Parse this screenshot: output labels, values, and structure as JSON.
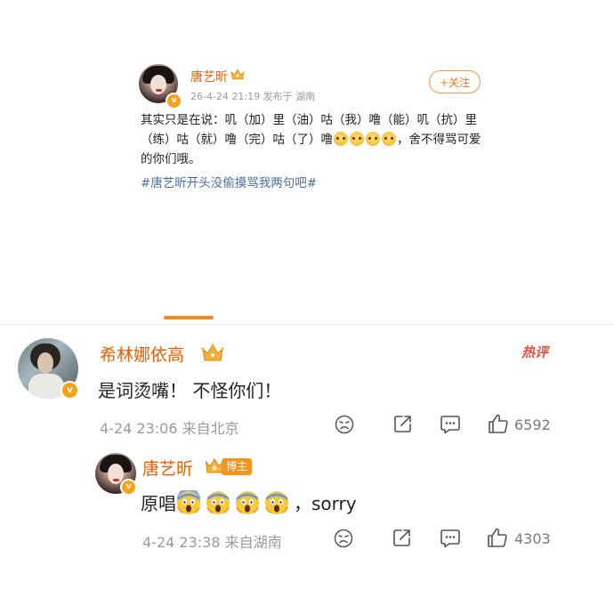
{
  "post": {
    "author": "唐艺昕",
    "verified_mark": "v",
    "meta": "26-4-24 21:19  发布于 湖南",
    "follow_label": "+关注",
    "text_part1": "其实只是在说：叽（加）里（油）咕（我）噜（能）叽（抗）里（练）咕（就）噜（完）咕（了）噜",
    "text_part2": "，舍不得骂可爱的你们哦。",
    "text_emojis": [
      "crying-face-emoji",
      "crying-face-emoji",
      "crying-face-emoji",
      "crying-face-emoji"
    ],
    "hashtag": "#唐艺昕开头没偷摸骂我两句吧#"
  },
  "comment": {
    "author": "希林娜依高",
    "hot_label": "热评",
    "text": "是词烫嘴！ 不怪你们！",
    "meta": "4-24 23:06  来自北京",
    "like_count": "6592",
    "actions": [
      "dislike-icon",
      "share-icon",
      "comment-icon",
      "like-icon"
    ]
  },
  "reply": {
    "author": "唐艺昕",
    "badge": "博主",
    "text_suffix": "，sorry",
    "emojis": [
      "scream-emoji",
      "scream-emoji",
      "scream-emoji",
      "scream-emoji"
    ],
    "meta": "4-24 23:38  来自湖南",
    "like_count": "4303"
  },
  "colors": {
    "name_orange": "#f25d00",
    "accent_orange": "#f7891e",
    "hashtag_blue": "#4a6e9a",
    "meta_gray": "#9a9a9a",
    "hot_red": "#ee4b3b"
  }
}
